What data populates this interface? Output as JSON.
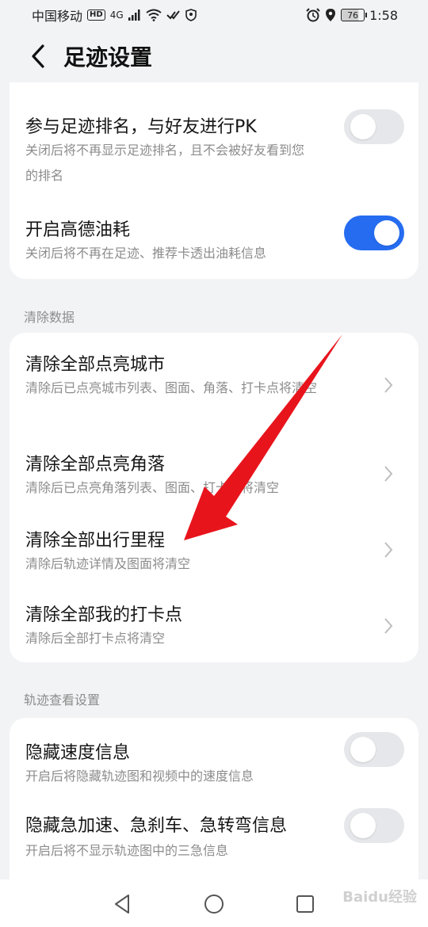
{
  "status_bar": {
    "carrier": "中国移动",
    "hd": "HD",
    "network": "4G",
    "battery": "76",
    "time": "1:58"
  },
  "header": {
    "title": "足迹设置"
  },
  "privacy_card": {
    "items": [
      {
        "title": "参与足迹排名，与好友进行PK",
        "desc": "关闭后将不再显示足迹排名，且不会被好友看到您的排名",
        "toggle": "off"
      },
      {
        "title": "开启高德油耗",
        "desc": "关闭后将不再在足迹、推荐卡透出油耗信息",
        "toggle": "on"
      }
    ]
  },
  "clear_section": {
    "label": "清除数据",
    "items": [
      {
        "title": "清除全部点亮城市",
        "desc": "清除后已点亮城市列表、图面、角落、打卡点将清空"
      },
      {
        "title": "清除全部点亮角落",
        "desc": "清除后已点亮角落列表、图面、打卡点将清空"
      },
      {
        "title": "清除全部出行里程",
        "desc": "清除后轨迹详情及图面将清空"
      },
      {
        "title": "清除全部我的打卡点",
        "desc": "清除后全部打卡点将清空"
      }
    ]
  },
  "track_section": {
    "label": "轨迹查看设置",
    "items": [
      {
        "title": "隐藏速度信息",
        "desc": "开启后将隐藏轨迹图和视频中的速度信息",
        "toggle": "off"
      },
      {
        "title": "隐藏急加速、急刹车、急转弯信息",
        "desc": "开启后将不显示轨迹图中的三急信息",
        "toggle": "off"
      }
    ]
  },
  "watermark": "Baidu经验",
  "colors": {
    "accent": "#256cf0",
    "background": "#f2f3f5",
    "arrow": "#e8141c"
  }
}
